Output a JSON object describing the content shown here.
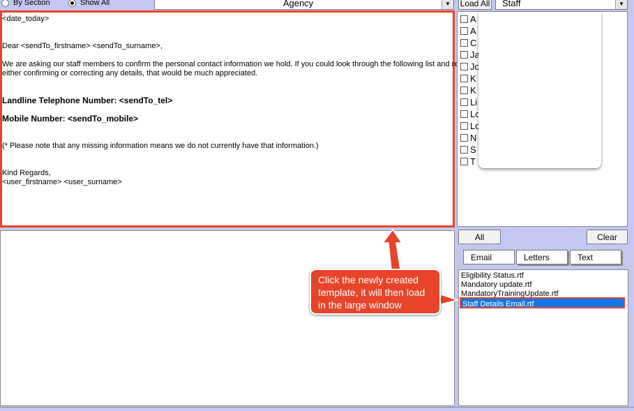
{
  "filters": {
    "by_section_label": "By Section",
    "show_all_label": "Show All",
    "selected": "Show All"
  },
  "agency_combo": {
    "value": "Agency"
  },
  "load_all_label": "Load All",
  "staff_combo": {
    "value": "Staff"
  },
  "editor": {
    "date_line": "<date_today>",
    "greeting": "Dear <sendTo_firstname> <sendTo_surname>,",
    "intro_line1": "We are asking our staff members to confirm the personal contact information we hold. If you could look through the following list and reply",
    "intro_line2": "either confirming or correcting any details, that would be much appreciated.",
    "landline_line": "Landline Telephone Number: <sendTo_tel>",
    "mobile_line": "Mobile Number: <sendTo_mobile>",
    "note_line": "(* Please note that any missing information means we do not currently have that information.)",
    "closing": "Kind Regards,",
    "signature": "<user_firstname> <user_surname>"
  },
  "staff_list": {
    "items": [
      {
        "initial": "A"
      },
      {
        "initial": "A"
      },
      {
        "initial": "C"
      },
      {
        "initial": "Ja"
      },
      {
        "initial": "Jo"
      },
      {
        "initial": "K"
      },
      {
        "initial": "K"
      },
      {
        "initial": "Li"
      },
      {
        "initial": "Lo"
      },
      {
        "initial": "Lo"
      },
      {
        "initial": "N"
      },
      {
        "initial": "S"
      },
      {
        "initial": "T"
      }
    ]
  },
  "buttons": {
    "all_label": "All",
    "clear_label": "Clear"
  },
  "tabs": {
    "email": "Email",
    "letters": "Letters",
    "text": "Text",
    "active": "Email"
  },
  "templates": {
    "files": [
      "Eligibility Status.rtf",
      "Mandatory update.rtf",
      "MandatoryTrainingUpdate.rtf",
      "Staff Details Email.rtf"
    ],
    "selected": "Staff Details Email.rtf"
  },
  "callout": {
    "line1": "Click the newly created",
    "line2": "template, it will then load",
    "line3": "in the large window"
  },
  "colors": {
    "annotation": "#e8442a",
    "selection": "#1177e6",
    "background": "#c3c7f2"
  }
}
